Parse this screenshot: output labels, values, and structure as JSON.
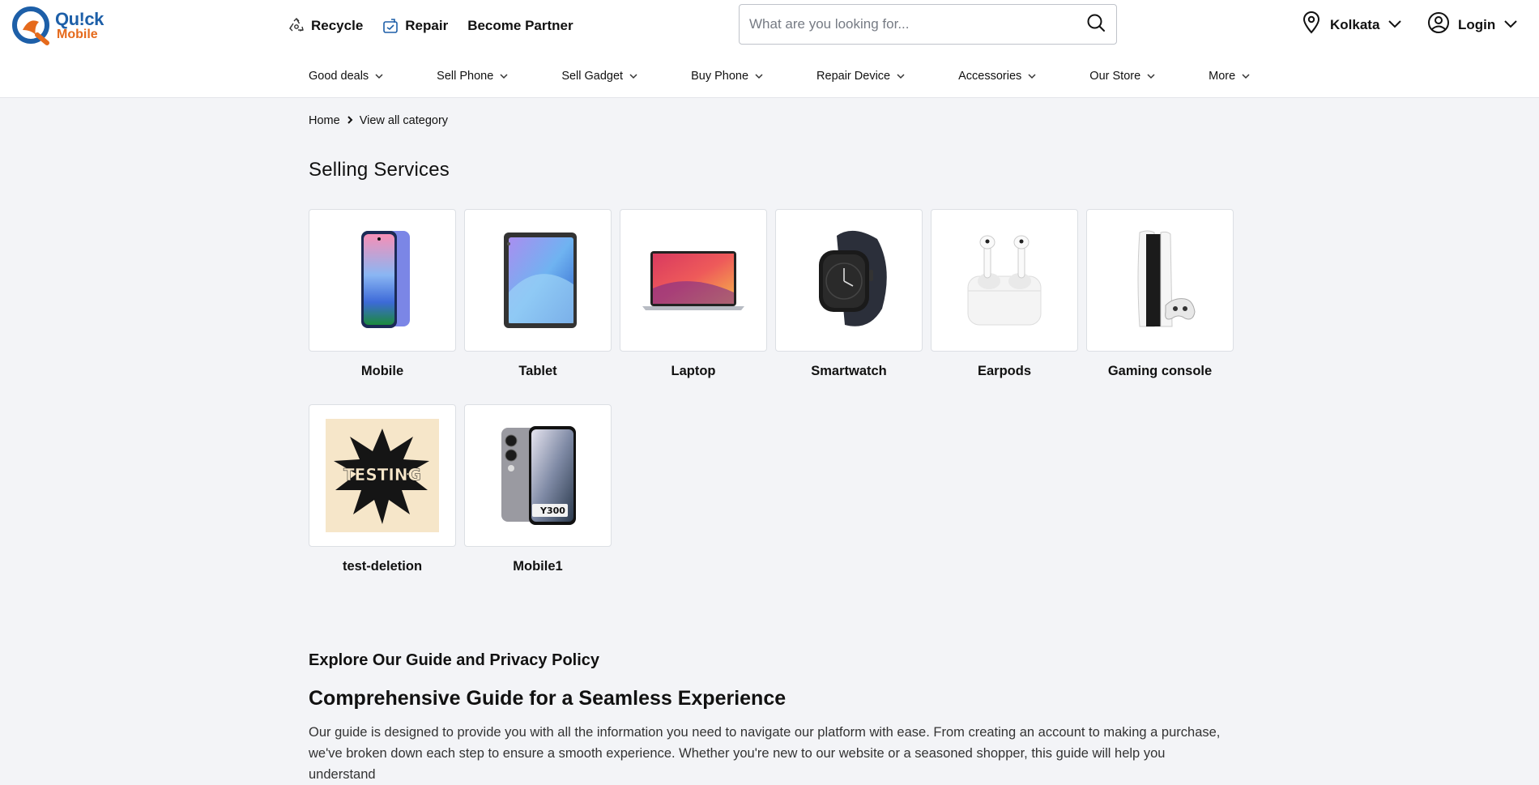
{
  "brand": {
    "name_top": "Qu!ck",
    "name_bottom": "Mobile",
    "primary": "#1d5fa8",
    "accent": "#e56a1c"
  },
  "topnav": {
    "recycle": {
      "label": "Recycle",
      "icon": "recycle-icon"
    },
    "repair": {
      "label": "Repair",
      "icon": "repair-icon"
    },
    "partner": {
      "label": "Become Partner"
    }
  },
  "search": {
    "placeholder": "What are you looking for...",
    "value": "",
    "icon": "search-icon"
  },
  "location": {
    "city": "Kolkata",
    "icon": "map-pin-icon"
  },
  "login": {
    "label": "Login",
    "icon": "user-icon"
  },
  "categories": [
    {
      "label": "Good deals"
    },
    {
      "label": "Sell Phone"
    },
    {
      "label": "Sell Gadget"
    },
    {
      "label": "Buy Phone"
    },
    {
      "label": "Repair Device"
    },
    {
      "label": "Accessories"
    },
    {
      "label": "Our Store"
    },
    {
      "label": "More"
    }
  ],
  "breadcrumb": {
    "home": "Home",
    "current": "View all category"
  },
  "selling": {
    "title": "Selling Services",
    "items": [
      {
        "label": "Mobile",
        "icon": "phone-image"
      },
      {
        "label": "Tablet",
        "icon": "tablet-image"
      },
      {
        "label": "Laptop",
        "icon": "laptop-image"
      },
      {
        "label": "Smartwatch",
        "icon": "smartwatch-image"
      },
      {
        "label": "Earpods",
        "icon": "earpods-image"
      },
      {
        "label": "Gaming console",
        "icon": "console-image"
      },
      {
        "label": "test-deletion",
        "icon": "testing-image",
        "image_text": "TESTING"
      },
      {
        "label": "Mobile1",
        "icon": "phone-y300-image",
        "image_text": "Y300"
      }
    ]
  },
  "guide": {
    "heading": "Explore Our Guide and Privacy Policy",
    "title": "Comprehensive Guide for a Seamless Experience",
    "text": "Our guide is designed to provide you with all the information you need to navigate our platform with ease. From creating an account to making a purchase, we've broken down each step to ensure a smooth experience. Whether you're new to our website or a seasoned shopper, this guide will help you understand"
  }
}
